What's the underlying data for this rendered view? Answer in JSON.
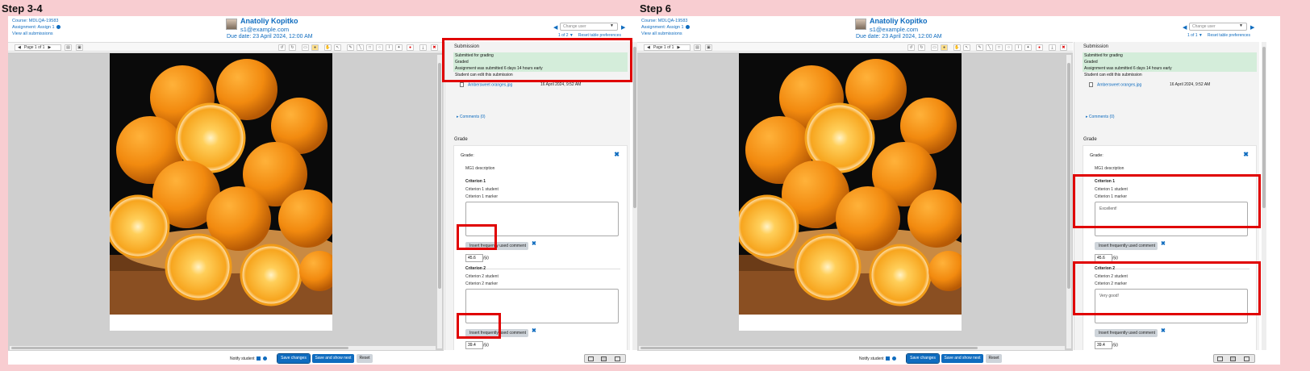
{
  "steps": [
    {
      "label": "Step 3-4",
      "crit1_marker_value": "",
      "crit2_marker_value": "",
      "total_counter": "1 of 2"
    },
    {
      "label": "Step 6",
      "crit1_marker_value": "Excellent!",
      "crit2_marker_value": "Very good!",
      "total_counter": "1 of 1"
    }
  ],
  "header": {
    "course": "Course: MDLQA-19583",
    "assignment": "Assignment: Assign 1",
    "view_all": "View all submissions",
    "user_name": "Anatoliy Kopitko",
    "user_email": "s1@example.com",
    "due_date": "Due date: 23 April 2024, 12:00 AM",
    "change_user_placeholder": "Change user",
    "reset_prefs": "Reset table preferences"
  },
  "toolbar": {
    "page_label": "Page 1 of 1"
  },
  "submission": {
    "title": "Submission",
    "status": [
      "Submitted for grading",
      "Graded",
      "Assignment was submitted 6 days 14 hours early",
      "Student can edit this submission"
    ],
    "file_name": "Ambersweet oranges.jpg",
    "file_date": "16 April 2024, 9:52 AM",
    "comments": "Comments (0)"
  },
  "grade": {
    "section_title": "Grade",
    "label": "Grade:",
    "description": "MG1 description",
    "criteria": [
      {
        "title": "Criterion 1",
        "student_label": "Criterion 1 student",
        "marker_label": "Criterion 1 marker",
        "insert_label": "Insert frequently used comment",
        "score": "45.6",
        "max": "/50"
      },
      {
        "title": "Criterion 2",
        "student_label": "Criterion 2 student",
        "marker_label": "Criterion 2 marker",
        "insert_label": "Insert frequently used comment",
        "score": "39.4",
        "max": "/50"
      }
    ]
  },
  "footer": {
    "notify": "Notify student",
    "save": "Save changes",
    "save_next": "Save and show next",
    "reset": "Reset"
  },
  "colors": {
    "background": "#f8cdd1",
    "accent": "#0f6cbf",
    "highlight": "#e00000",
    "success_bg": "#d4edda"
  }
}
